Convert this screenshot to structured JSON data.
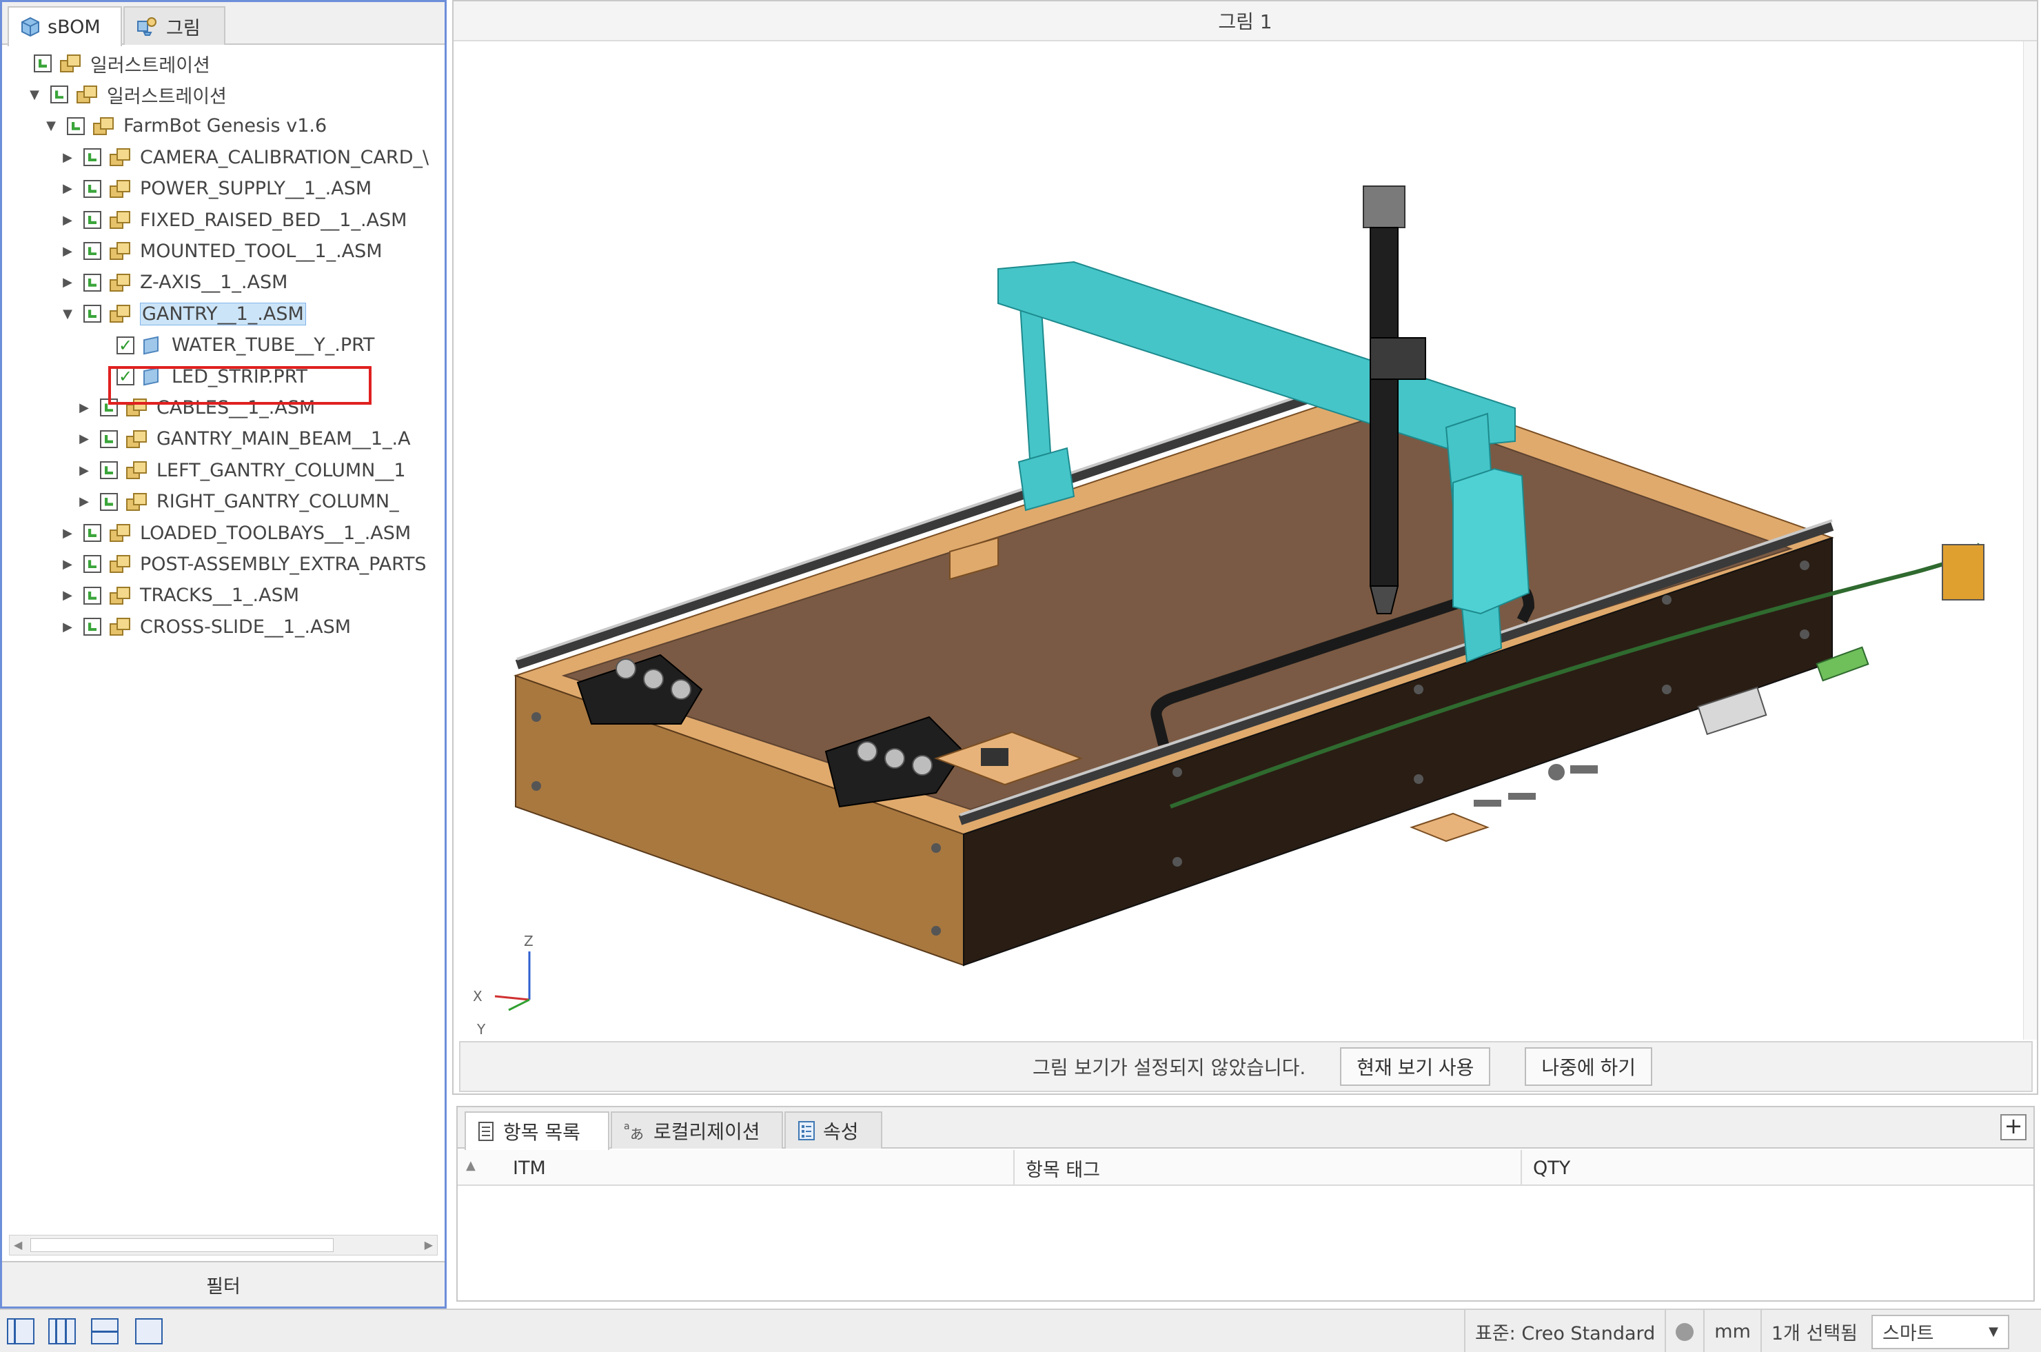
{
  "left_panel": {
    "tabs": [
      {
        "label": "sBOM",
        "icon": "cube-icon"
      },
      {
        "label": "그림",
        "icon": "figure-icon"
      }
    ],
    "tree": [
      {
        "label": "일러스트레이션",
        "icon": "assembly-icon",
        "state": "include"
      },
      {
        "label": "일러스트레이션",
        "icon": "assembly-icon",
        "state": "include",
        "expanded": true
      },
      {
        "label": "FarmBot Genesis v1.6",
        "icon": "assembly-icon",
        "state": "include",
        "expanded": true
      },
      {
        "label": "CAMERA_CALIBRATION_CARD_\\",
        "icon": "assembly-icon",
        "state": "include"
      },
      {
        "label": "POWER_SUPPLY__1_.ASM",
        "icon": "assembly-icon",
        "state": "include"
      },
      {
        "label": "FIXED_RAISED_BED__1_.ASM",
        "icon": "assembly-icon",
        "state": "include"
      },
      {
        "label": "MOUNTED_TOOL__1_.ASM",
        "icon": "assembly-icon",
        "state": "include"
      },
      {
        "label": "Z-AXIS__1_.ASM",
        "icon": "assembly-icon",
        "state": "include"
      },
      {
        "label": "GANTRY__1_.ASM",
        "icon": "assembly-icon",
        "state": "include",
        "expanded": true,
        "selected": true
      },
      {
        "label": "WATER_TUBE__Y_.PRT",
        "icon": "part-icon",
        "state": "checked"
      },
      {
        "label": "LED_STRIP.PRT",
        "icon": "part-icon",
        "state": "checked"
      },
      {
        "label": "CABLES__1_.ASM",
        "icon": "assembly-icon",
        "state": "include",
        "highlighted": true
      },
      {
        "label": "GANTRY_MAIN_BEAM__1_.A",
        "icon": "assembly-icon",
        "state": "include"
      },
      {
        "label": "LEFT_GANTRY_COLUMN__1",
        "icon": "assembly-icon",
        "state": "include"
      },
      {
        "label": "RIGHT_GANTRY_COLUMN_",
        "icon": "assembly-icon",
        "state": "include"
      },
      {
        "label": "LOADED_TOOLBAYS__1_.ASM",
        "icon": "assembly-icon",
        "state": "include"
      },
      {
        "label": "POST-ASSEMBLY_EXTRA_PARTS",
        "icon": "assembly-icon",
        "state": "include"
      },
      {
        "label": "TRACKS__1_.ASM",
        "icon": "assembly-icon",
        "state": "include"
      },
      {
        "label": "CROSS-SLIDE__1_.ASM",
        "icon": "assembly-icon",
        "state": "include"
      }
    ],
    "filter_label": "필터"
  },
  "viewport": {
    "title": "그림 1",
    "axis_labels": {
      "z": "Z",
      "x": "X",
      "y": "Y"
    },
    "view_message": "그림 보기가 설정되지 않았습니다.",
    "use_current_view_label": "현재 보기 사용",
    "later_label": "나중에 하기"
  },
  "items_panel": {
    "tabs": [
      {
        "label": "항목 목록",
        "icon": "list-icon"
      },
      {
        "label": "로컬리제이션",
        "icon": "localization-icon"
      },
      {
        "label": "속성",
        "icon": "properties-icon"
      }
    ],
    "add_label": "+",
    "columns": [
      "ITM",
      "항목 태그",
      "QTY"
    ],
    "rows": []
  },
  "status_bar": {
    "standard": "표준: Creo Standard",
    "units": "mm",
    "selection_count": "1개 선택됨",
    "filter_value": "스마트"
  },
  "colors": {
    "accent": "#6d8ed9",
    "highlight_box": "#e02020",
    "gantry_teal": "#45c5c8",
    "bed_wood": "#d9a566",
    "soil": "#7a5a44"
  }
}
